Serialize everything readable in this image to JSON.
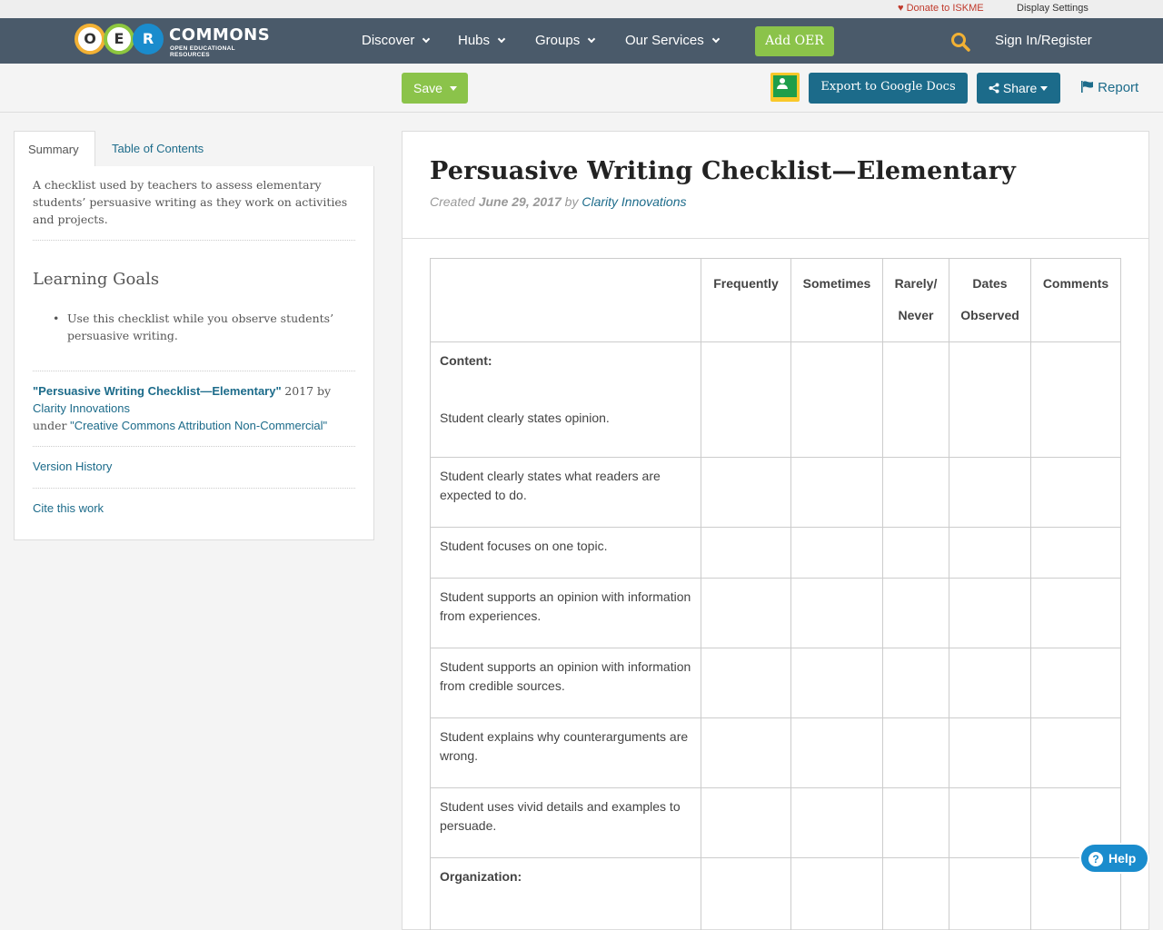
{
  "utility": {
    "donate": "♥ Donate to ISKME",
    "display_settings": "Display Settings"
  },
  "logo": {
    "letters": [
      "O",
      "E",
      "R"
    ],
    "brand": "COMMONS",
    "tagline": "OPEN EDUCATIONAL RESOURCES"
  },
  "nav": {
    "items": [
      "Discover",
      "Hubs",
      "Groups",
      "Our Services"
    ],
    "add_oer": "Add OER",
    "sign_in": "Sign In/Register"
  },
  "toolbar": {
    "save": "Save",
    "export": "Export to Google Docs",
    "share": "Share",
    "report": "Report"
  },
  "sidebar": {
    "tabs": [
      "Summary",
      "Table of Contents"
    ],
    "summary": "A checklist used by teachers to assess elementary students’ persuasive writing as they work on activities and projects.",
    "learning_goals_title": "Learning Goals",
    "learning_goals": [
      "Use this checklist while you observe students’ persuasive writing."
    ],
    "attribution": {
      "title": "\"Persuasive Writing Checklist—Elementary\"",
      "year": "2017 by",
      "author": "Clarity Innovations",
      "under": "under",
      "license": "\"Creative Commons Attribution Non-Commercial\""
    },
    "version_history": "Version History",
    "cite": "Cite this work"
  },
  "resource": {
    "title": "Persuasive Writing Checklist—Elementary",
    "created_label": "Created",
    "created_date": "June 29, 2017",
    "by": "by",
    "author": "Clarity Innovations"
  },
  "table": {
    "headers": [
      "",
      "Frequently",
      "Sometimes",
      "Rarely/ Never",
      "Dates Observed",
      "Comments"
    ],
    "rows": [
      {
        "section": "Content:",
        "text": "Student clearly states opinion."
      },
      {
        "section": "",
        "text": "Student clearly states what readers are expected to do."
      },
      {
        "section": "",
        "text": "Student focuses on one topic."
      },
      {
        "section": "",
        "text": "Student supports an opinion with information from experiences."
      },
      {
        "section": "",
        "text": "Student supports an opinion with information from credible sources."
      },
      {
        "section": "",
        "text": "Student explains why counterarguments are wrong."
      },
      {
        "section": "",
        "text": "Student uses vivid details and examples to persuade."
      },
      {
        "section": "Organization:",
        "text": ""
      }
    ]
  },
  "help": "Help",
  "colors": {
    "nav_bg": "#4a5a6a",
    "green": "#8bc34a",
    "blue": "#1c6b8a",
    "search_icon": "#f2b134"
  }
}
